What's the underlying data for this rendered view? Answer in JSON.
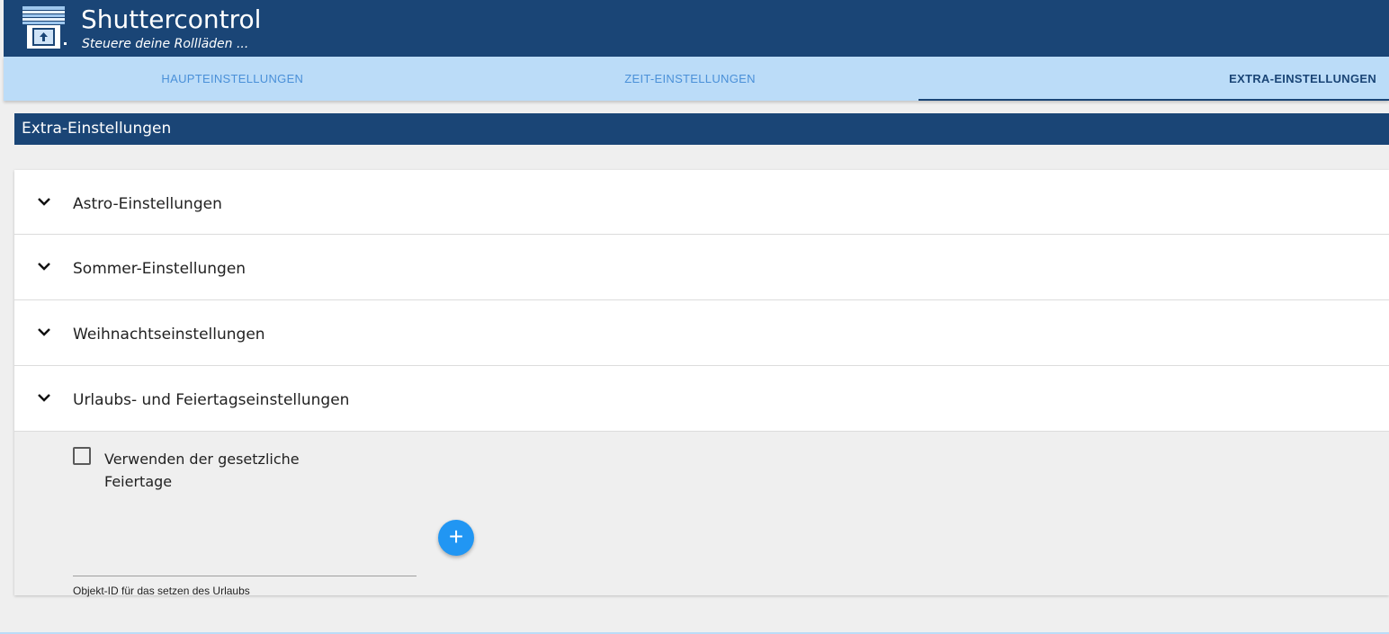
{
  "header": {
    "title": "Shuttercontrol",
    "subtitle": "Steuere deine Rollläden ..."
  },
  "tabs": [
    {
      "label": "HAUPTEINSTELLUNGEN",
      "active": false
    },
    {
      "label": "ZEIT-EINSTELLUNGEN",
      "active": false
    },
    {
      "label": "EXTRA-EINSTELLUNGEN",
      "active": true
    }
  ],
  "section": {
    "title": "Extra-Einstellungen"
  },
  "accordion": {
    "items": [
      {
        "label": "Astro-Einstellungen",
        "icon": "chevron-down-icon"
      },
      {
        "label": "Sommer-Einstellungen",
        "icon": "chevron-down-icon"
      },
      {
        "label": "Weihnachtseinstellungen",
        "icon": "chevron-down-icon"
      },
      {
        "label": "Urlaubs- und Feiertagseinstellungen",
        "icon": "chevron-down-icon"
      }
    ],
    "open_panel": {
      "checkbox_label": "Verwenden der gesetzliche Feiertage",
      "checkbox_checked": false,
      "add_button_symbol": "+",
      "object_id_value": "",
      "object_id_label": "Objekt-ID für das setzen des Urlaubs"
    }
  },
  "colors": {
    "header_bg": "#1a4576",
    "tabs_bg": "#bbdcf8",
    "tab_text": "#4a90d8",
    "fab": "#2196f3"
  }
}
